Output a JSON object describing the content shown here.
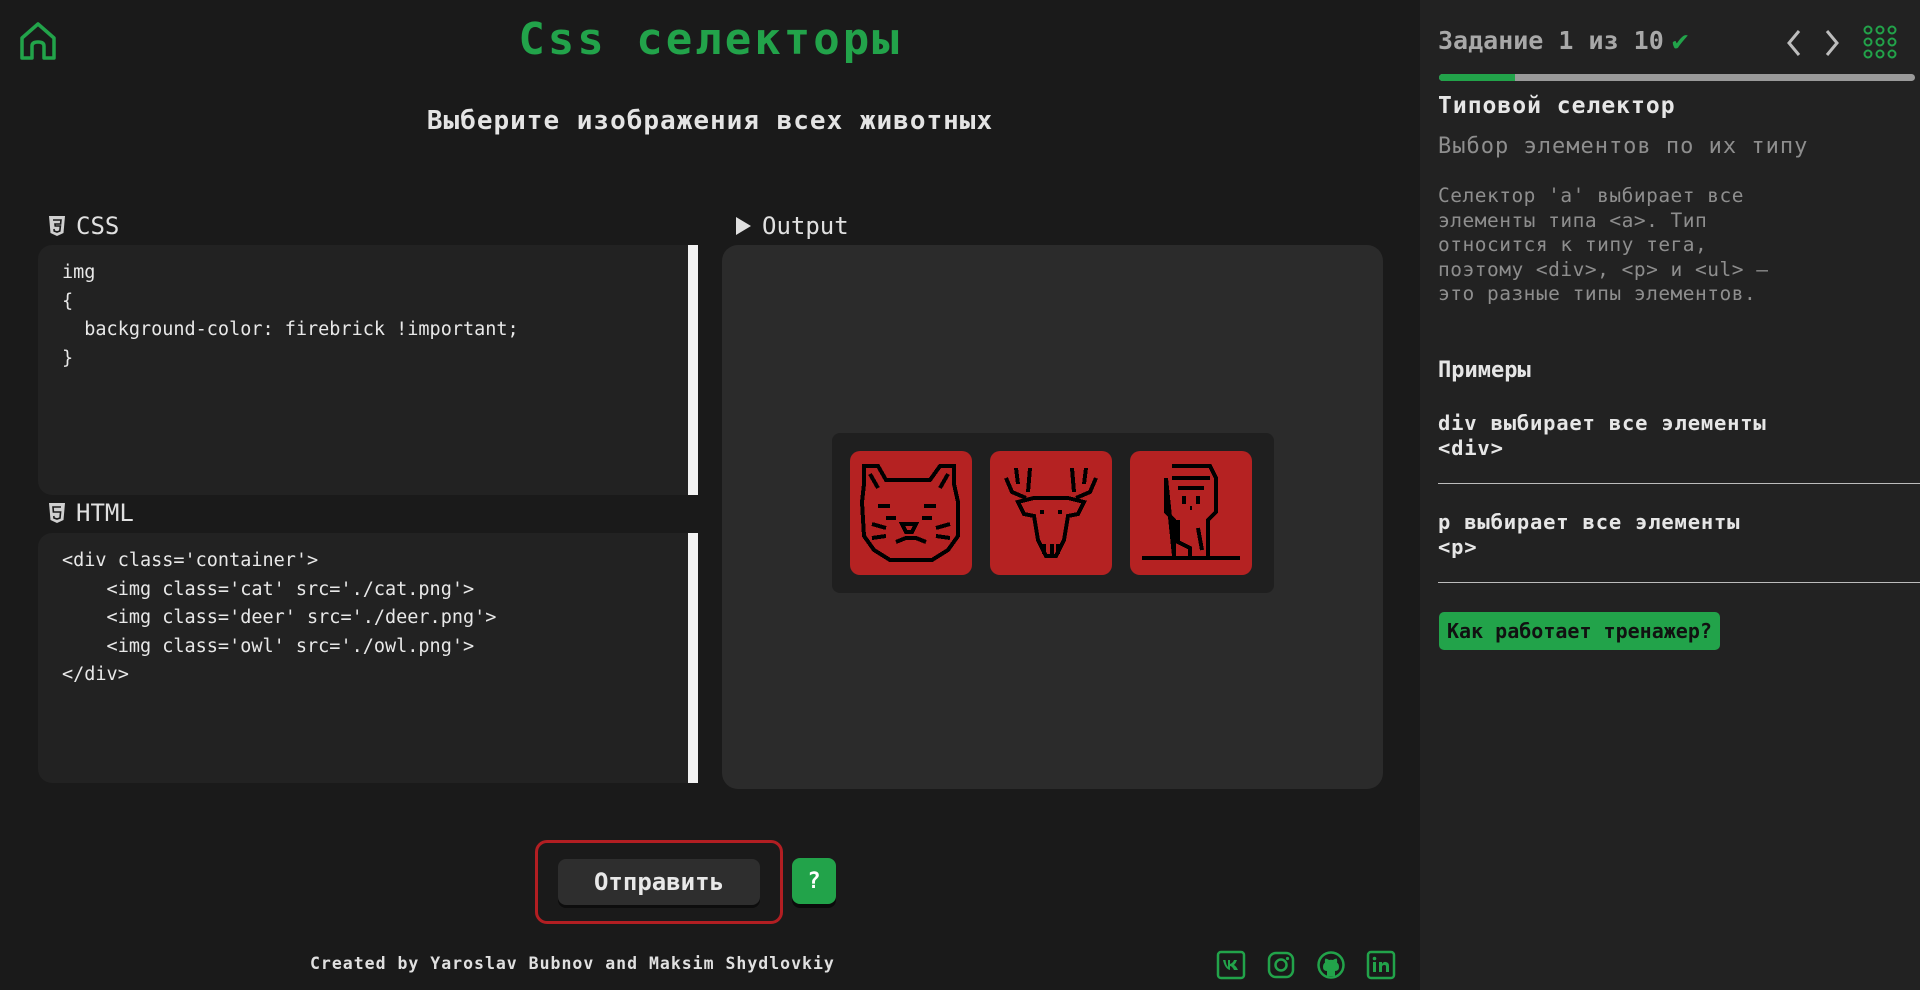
{
  "header": {
    "title": "Css селекторы",
    "subtitle": "Выберите изображения всех животных"
  },
  "css_panel": {
    "label": "CSS",
    "code": "img\n{\n  background-color: firebrick !important;\n}"
  },
  "html_panel": {
    "label": "HTML",
    "code": "<div class='container'>\n    <img class='cat' src='./cat.png'>\n    <img class='deer' src='./deer.png'>\n    <img class='owl' src='./owl.png'>\n</div>"
  },
  "output_panel": {
    "label": "Output",
    "items": [
      {
        "name": "cat",
        "icon": "cat-pixel-icon"
      },
      {
        "name": "deer",
        "icon": "deer-pixel-icon"
      },
      {
        "name": "owl",
        "icon": "owl-pixel-icon"
      }
    ],
    "highlight_color": "#b52222"
  },
  "actions": {
    "submit_label": "Отправить",
    "help_label": "?"
  },
  "footer": {
    "credits": "Created by Yaroslav Bubnov and Maksim Shydlovkiy",
    "social": [
      "vk-icon",
      "instagram-icon",
      "github-icon",
      "linkedin-icon"
    ]
  },
  "sidebar": {
    "task_counter": "Задание 1 из 10",
    "progress": 0.16,
    "level_title": "Типовой селектор",
    "level_subtitle": "Выбор элементов по их типу",
    "description": "Селектор 'a' выбирает все\nэлементы типа <a>. Тип\nотносится к типу тега,\nпоэтому <div>, <p> и <ul> —\nэто разные типы элементов.",
    "examples_heading": "Примеры",
    "examples": [
      "div выбирает все элементы\n<div>",
      "p выбирает все элементы\n<p>"
    ],
    "how_it_works_label": "Как работает тренажер?"
  },
  "colors": {
    "accent": "#22a34a",
    "background": "#1a1a1a",
    "sidebar": "#222222",
    "submit_border": "#b21e22"
  }
}
